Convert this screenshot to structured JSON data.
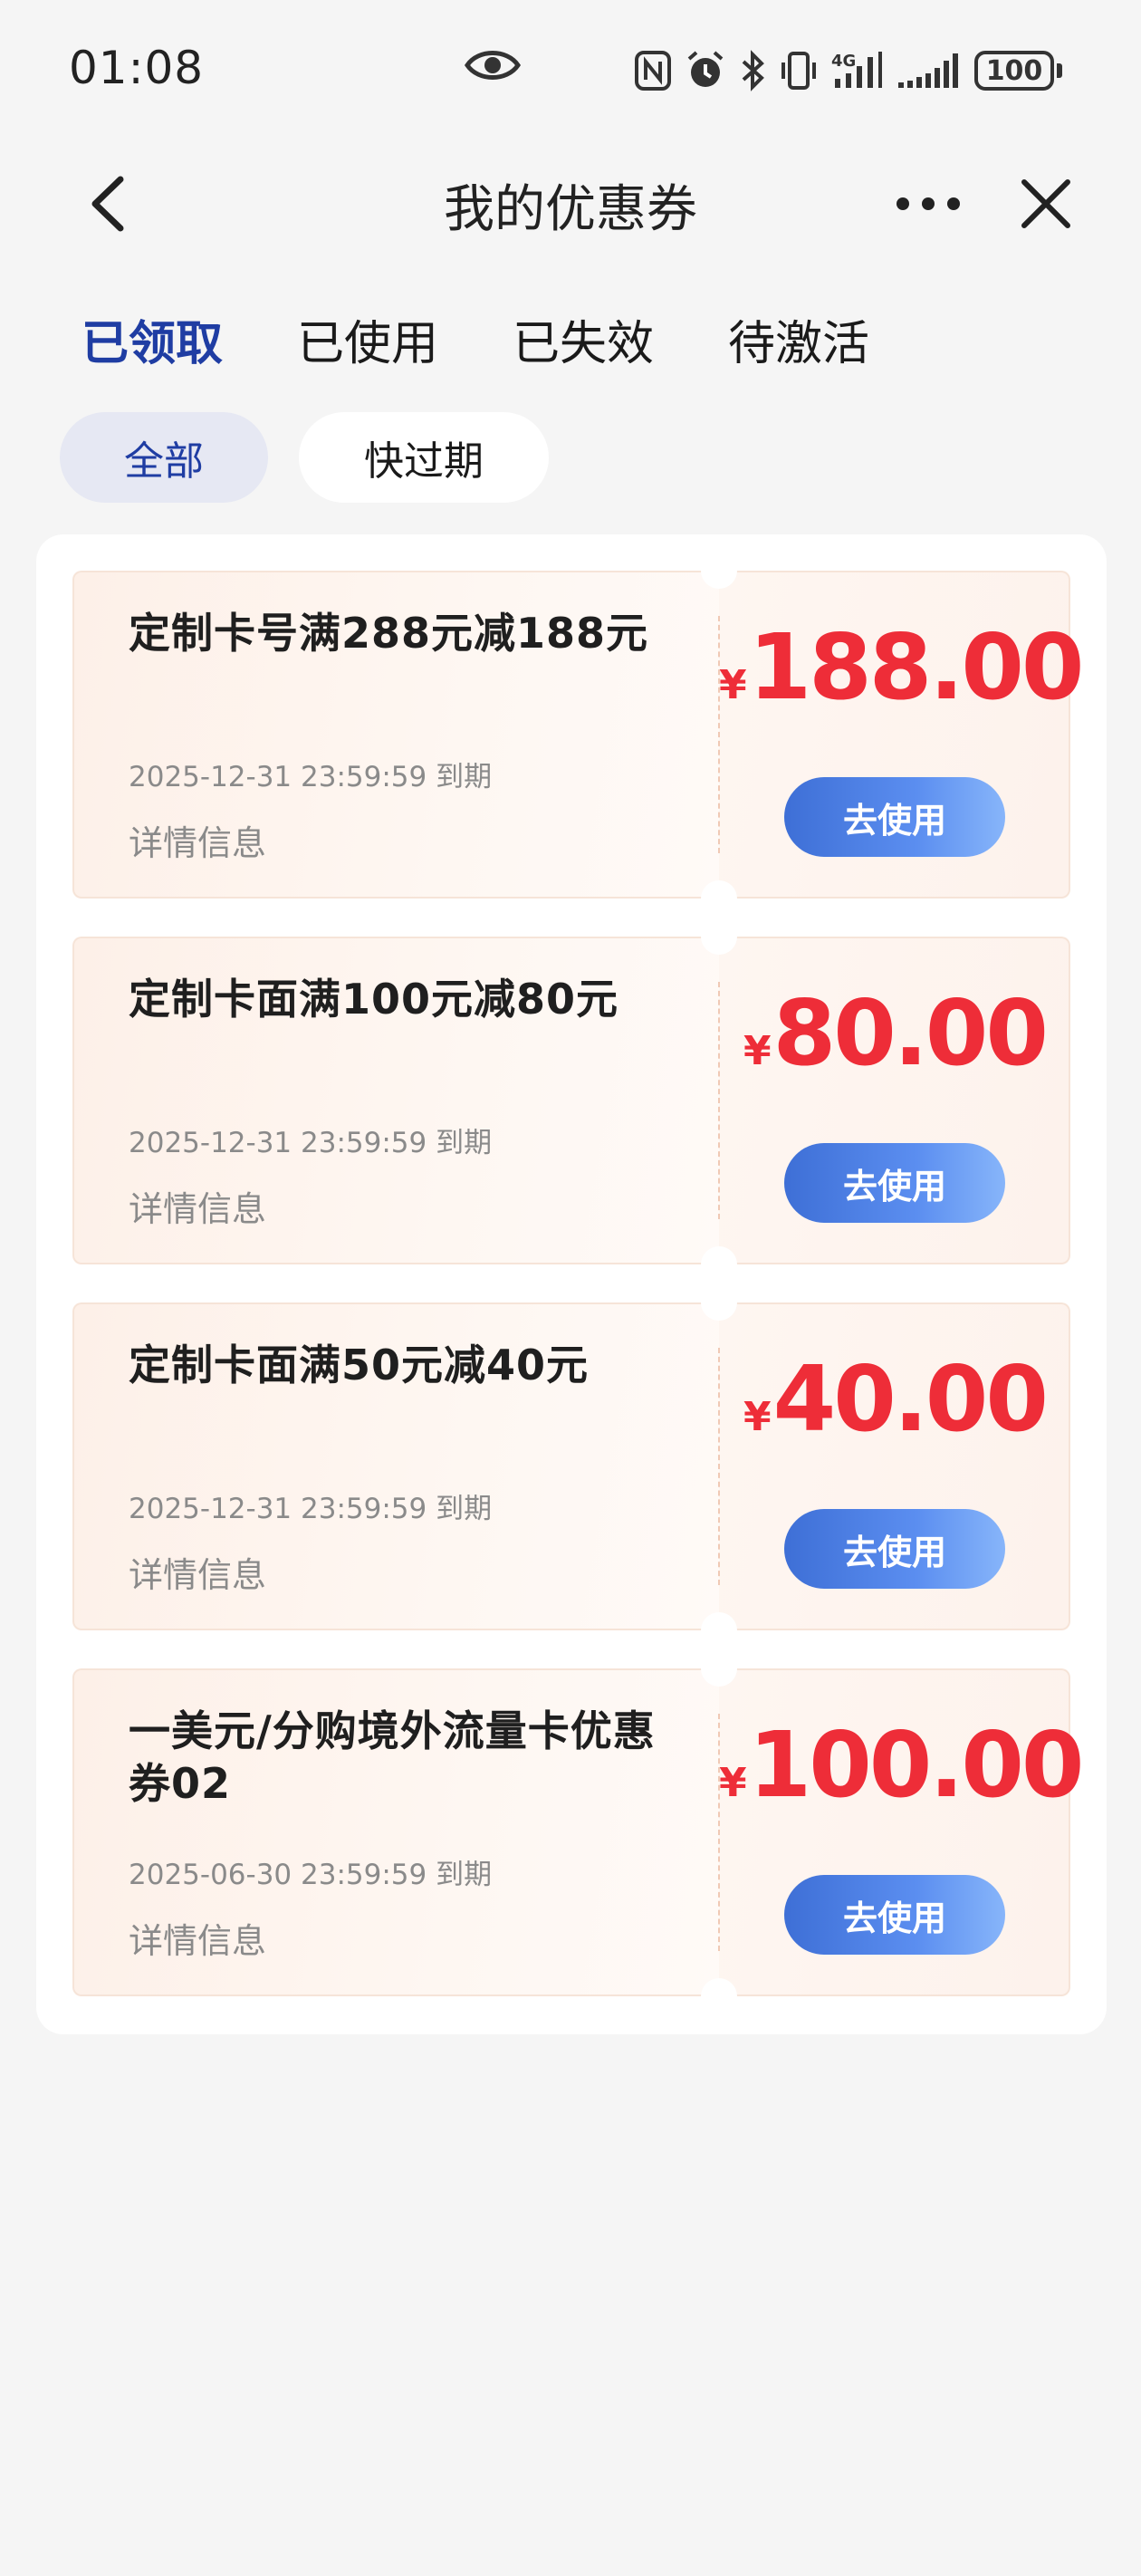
{
  "status_bar": {
    "time": "01:08",
    "battery": "100",
    "icons": [
      "eye-icon",
      "nfc-icon",
      "alarm-icon",
      "bluetooth-icon",
      "vibrate-icon",
      "signal-4g-icon",
      "signal-icon",
      "battery-icon"
    ]
  },
  "header": {
    "title": "我的优惠券",
    "back_icon": "chevron-left-icon",
    "more_icon": "more-icon",
    "close_icon": "close-icon"
  },
  "tabs": [
    {
      "label": "已领取",
      "active": true
    },
    {
      "label": "已使用",
      "active": false
    },
    {
      "label": "已失效",
      "active": false
    },
    {
      "label": "待激活",
      "active": false
    }
  ],
  "filters": [
    {
      "label": "全部",
      "selected": true
    },
    {
      "label": "快过期",
      "selected": false
    }
  ],
  "coupons": [
    {
      "title": "定制卡号满288元减188元",
      "expire": "2025-12-31 23:59:59 到期",
      "detail": "详情信息",
      "currency": "¥",
      "amount": "188.00",
      "button": "去使用"
    },
    {
      "title": "定制卡面满100元减80元",
      "expire": "2025-12-31 23:59:59 到期",
      "detail": "详情信息",
      "currency": "¥",
      "amount": "80.00",
      "button": "去使用"
    },
    {
      "title": "定制卡面满50元减40元",
      "expire": "2025-12-31 23:59:59 到期",
      "detail": "详情信息",
      "currency": "¥",
      "amount": "40.00",
      "button": "去使用"
    },
    {
      "title": "一美元/分购境外流量卡优惠券02",
      "expire": "2025-06-30 23:59:59 到期",
      "detail": "详情信息",
      "currency": "¥",
      "amount": "100.00",
      "button": "去使用"
    }
  ],
  "colors": {
    "accent_blue": "#1f3da3",
    "price_red": "#ee2d38",
    "button_blue": "#4a7ee3",
    "background": "#f5f5f5"
  }
}
